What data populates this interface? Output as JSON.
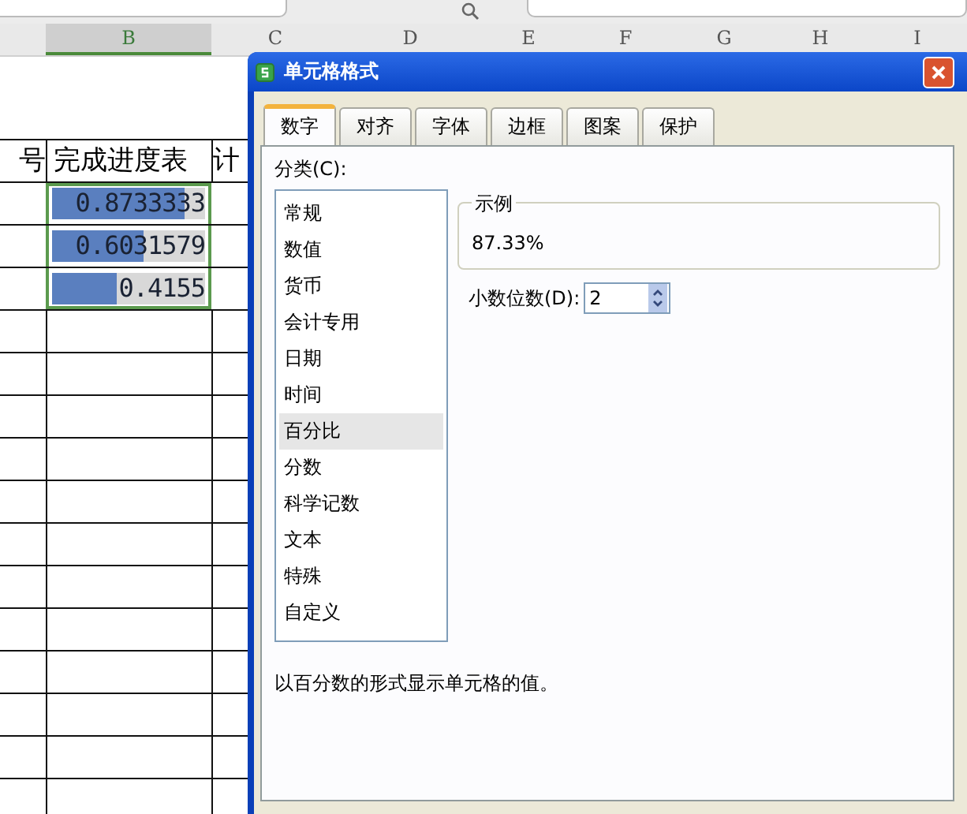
{
  "sheet": {
    "column_headers": [
      {
        "label": "B",
        "selected": true
      },
      {
        "label": "C",
        "selected": false
      },
      {
        "label": "D",
        "selected": false
      },
      {
        "label": "E",
        "selected": false
      },
      {
        "label": "F",
        "selected": false
      },
      {
        "label": "G",
        "selected": false
      },
      {
        "label": "H",
        "selected": false
      },
      {
        "label": "I",
        "selected": false
      }
    ],
    "header_row": [
      "号",
      "完成进度表",
      "计"
    ],
    "rows": [
      {
        "value": "0.8733333",
        "level": 0.87
      },
      {
        "value": "0.6031579",
        "level": 0.6
      },
      {
        "value": "0.4155",
        "level": 0.42
      }
    ]
  },
  "dialog": {
    "title": "单元格格式",
    "tabs": [
      {
        "label": "数字",
        "selected": true
      },
      {
        "label": "对齐",
        "selected": false
      },
      {
        "label": "字体",
        "selected": false
      },
      {
        "label": "边框",
        "selected": false
      },
      {
        "label": "图案",
        "selected": false
      },
      {
        "label": "保护",
        "selected": false
      }
    ],
    "category_label": "分类(C):",
    "categories": [
      {
        "label": "常规",
        "selected": false
      },
      {
        "label": "数值",
        "selected": false
      },
      {
        "label": "货币",
        "selected": false
      },
      {
        "label": "会计专用",
        "selected": false
      },
      {
        "label": "日期",
        "selected": false
      },
      {
        "label": "时间",
        "selected": false
      },
      {
        "label": "百分比",
        "selected": true
      },
      {
        "label": "分数",
        "selected": false
      },
      {
        "label": "科学记数",
        "selected": false
      },
      {
        "label": "文本",
        "selected": false
      },
      {
        "label": "特殊",
        "selected": false
      },
      {
        "label": "自定义",
        "selected": false
      }
    ],
    "sample_label": "示例",
    "sample_value": "87.33%",
    "decimal_label": "小数位数(D):",
    "decimal_value": "2",
    "description": "以百分数的形式显示单元格的值。"
  }
}
